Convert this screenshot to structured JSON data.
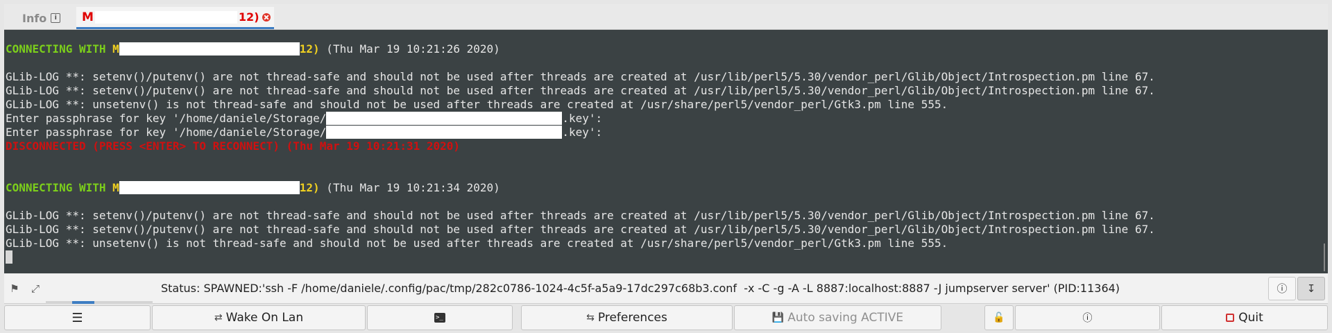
{
  "tabs": {
    "info": {
      "label": "Info",
      "icon": "info-icon"
    },
    "session": {
      "prefix": "M",
      "suffix": "12)",
      "close_icon": "close-icon"
    }
  },
  "terminal": {
    "connect1": {
      "label": "CONNECTING WITH ",
      "m": "M",
      "suffix": "12)",
      "time": " (Thu Mar 19 10:21:26 2020)"
    },
    "log1": "GLib-LOG **: setenv()/putenv() are not thread-safe and should not be used after threads are created at /usr/lib/perl5/5.30/vendor_perl/Glib/Object/Introspection.pm line 67.",
    "log2": "GLib-LOG **: setenv()/putenv() are not thread-safe and should not be used after threads are created at /usr/lib/perl5/5.30/vendor_perl/Glib/Object/Introspection.pm line 67.",
    "log3": "GLib-LOG **: unsetenv() is not thread-safe and should not be used after threads are created at /usr/share/perl5/vendor_perl/Gtk3.pm line 555.",
    "pass1": {
      "prefix": "Enter passphrase for key '/home/daniele/Storage/",
      "suffix": ".key':"
    },
    "pass2": {
      "prefix": "Enter passphrase for key '/home/daniele/Storage/",
      "suffix": ".key':"
    },
    "disconnected": "DISCONNECTED (PRESS <ENTER> TO RECONNECT) (Thu Mar 19 10:21:31 2020)",
    "connect2": {
      "label": "CONNECTING WITH ",
      "m": "M",
      "suffix": "12)",
      "time": " (Thu Mar 19 10:21:34 2020)"
    },
    "log4": "GLib-LOG **: setenv()/putenv() are not thread-safe and should not be used after threads are created at /usr/lib/perl5/5.30/vendor_perl/Glib/Object/Introspection.pm line 67.",
    "log5": "GLib-LOG **: setenv()/putenv() are not thread-safe and should not be used after threads are created at /usr/lib/perl5/5.30/vendor_perl/Glib/Object/Introspection.pm line 67.",
    "log6": "GLib-LOG **: unsetenv() is not thread-safe and should not be used after threads are created at /usr/share/perl5/vendor_perl/Gtk3.pm line 555."
  },
  "statusbar": {
    "status_text": "Status: SPAWNED:'ssh -F /home/daniele/.config/pac/tmp/282c0786-1024-4c5f-a5a9-17dc297c68b3.conf  -x -C -g -A -L 8887:localhost:8887 -J jumpserver server' (PID:11364)",
    "icons": [
      "flag-icon",
      "fullscreen-icon",
      "info-icon",
      "scroll-down-icon"
    ]
  },
  "toolbar": {
    "menu_icon": "menu-icon",
    "wake_on_lan": "Wake On Lan",
    "terminal_icon": "terminal-icon",
    "preferences": "Preferences",
    "auto_saving": "Auto saving ACTIVE",
    "lock_icon": "lock-icon",
    "about_icon": "about-icon",
    "quit": "Quit"
  },
  "colors": {
    "terminal_bg": "#3b4244",
    "connecting": "#7ccf1b",
    "highlight": "#f0d020",
    "disconnected": "#d01010",
    "tab_active_text": "#e00000",
    "accent": "#3d7dc2"
  }
}
